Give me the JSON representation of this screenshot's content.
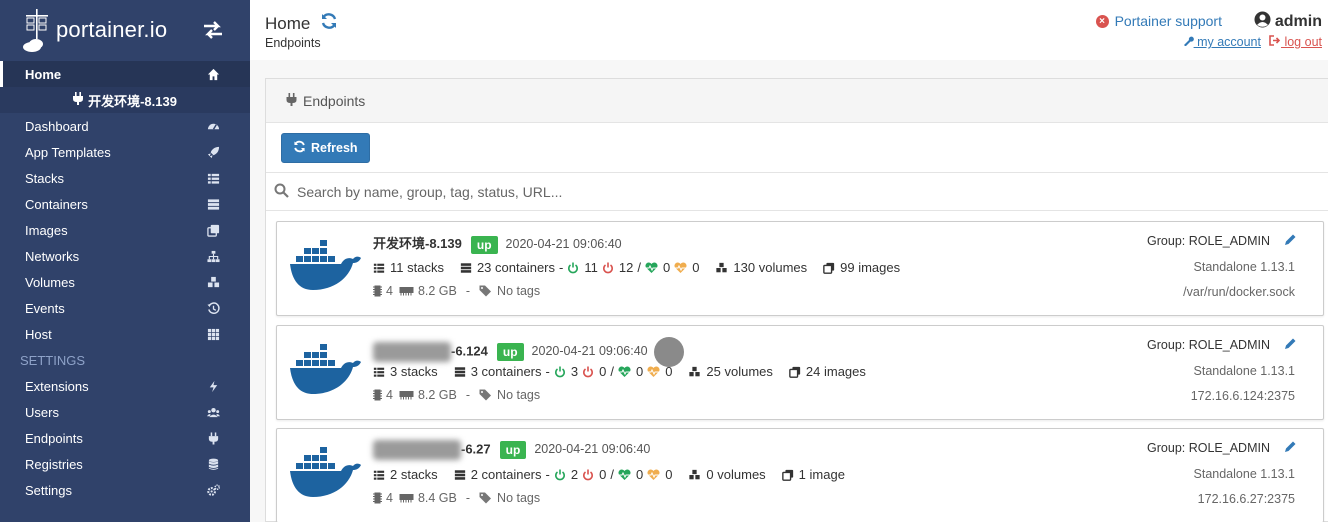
{
  "brand": {
    "name": "portainer.io"
  },
  "sidebar": {
    "home_label": "Home",
    "endpoint_name": "开发环境-8.139",
    "items": [
      {
        "label": "Dashboard",
        "icon": "tachometer-icon"
      },
      {
        "label": "App Templates",
        "icon": "rocket-icon"
      },
      {
        "label": "Stacks",
        "icon": "th-list-icon"
      },
      {
        "label": "Containers",
        "icon": "server-icon"
      },
      {
        "label": "Images",
        "icon": "clone-icon"
      },
      {
        "label": "Networks",
        "icon": "sitemap-icon"
      },
      {
        "label": "Volumes",
        "icon": "cubes-icon"
      },
      {
        "label": "Events",
        "icon": "history-icon"
      },
      {
        "label": "Host",
        "icon": "th-icon"
      }
    ],
    "section_label": "SETTINGS",
    "settings_items": [
      {
        "label": "Extensions",
        "icon": "bolt-icon"
      },
      {
        "label": "Users",
        "icon": "users-icon"
      },
      {
        "label": "Endpoints",
        "icon": "plug-icon"
      },
      {
        "label": "Registries",
        "icon": "database-icon"
      },
      {
        "label": "Settings",
        "icon": "cogs-icon"
      }
    ]
  },
  "header": {
    "title": "Home",
    "breadcrumb": "Endpoints",
    "support_label": "Portainer support",
    "username": "admin",
    "my_account": " my account",
    "log_out": " log out"
  },
  "widget": {
    "title": "Endpoints",
    "refresh_label": "Refresh",
    "search_placeholder": "Search by name, group, tag, status, URL..."
  },
  "endpoints": [
    {
      "name": "开发环境-8.139",
      "status": "up",
      "date": "2020-04-21 09:06:40",
      "stacks": "11 stacks",
      "containers": "23 containers",
      "running": "11",
      "stopped": "12",
      "healthy": "0",
      "unhealthy": "0",
      "volumes": "130 volumes",
      "images": "99 images",
      "cpu": "4",
      "memory": "8.2 GB",
      "tags": "No tags",
      "group": "Group: ROLE_ADMIN",
      "version": "Standalone 1.13.1",
      "url": "/var/run/docker.sock"
    },
    {
      "name": "-6.124",
      "status": "up",
      "date": "2020-04-21 09:06:40",
      "stacks": "3 stacks",
      "containers": "3 containers",
      "running": "3",
      "stopped": "0",
      "healthy": "0",
      "unhealthy": "0",
      "volumes": "25 volumes",
      "images": "24 images",
      "cpu": "4",
      "memory": "8.2 GB",
      "tags": "No tags",
      "group": "Group: ROLE_ADMIN",
      "version": "Standalone 1.13.1",
      "url": "172.16.6.124:2375"
    },
    {
      "name": "-6.27",
      "status": "up",
      "date": "2020-04-21 09:06:40",
      "stacks": "2 stacks",
      "containers": "2 containers",
      "running": "2",
      "stopped": "0",
      "healthy": "0",
      "unhealthy": "0",
      "volumes": "0 volumes",
      "images": "1 image",
      "cpu": "4",
      "memory": "8.4 GB",
      "tags": "No tags",
      "group": "Group: ROLE_ADMIN",
      "version": "Standalone 1.13.1",
      "url": "172.16.6.27:2375"
    }
  ],
  "colors": {
    "sidebar": "#30426a",
    "primary": "#337ab7",
    "success": "#3ab450",
    "danger": "#d9534f"
  }
}
